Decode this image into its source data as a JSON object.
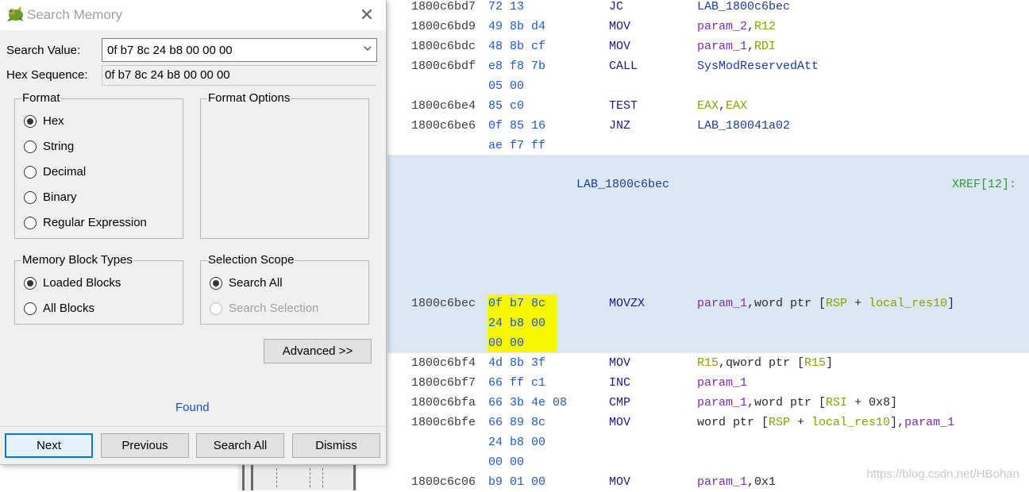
{
  "dialog": {
    "title": "Search Memory",
    "search_value_label": "Search Value:",
    "search_value": "0f b7 8c 24 b8 00 00 00",
    "hex_sequence_label": "Hex Sequence:",
    "hex_sequence": "0f b7 8c 24 b8 00 00 00",
    "format": {
      "title": "Format",
      "options": [
        "Hex",
        "String",
        "Decimal",
        "Binary",
        "Regular Expression"
      ],
      "selected": "Hex"
    },
    "format_options_title": "Format Options",
    "memory_block_types": {
      "title": "Memory Block Types",
      "options": [
        "Loaded Blocks",
        "All Blocks"
      ],
      "selected": "Loaded Blocks"
    },
    "selection_scope": {
      "title": "Selection Scope",
      "options": [
        "Search All",
        "Search Selection"
      ],
      "selected": "Search All"
    },
    "advanced_button": "Advanced >>",
    "status": "Found",
    "buttons": {
      "next": "Next",
      "previous": "Previous",
      "search_all": "Search All",
      "dismiss": "Dismiss"
    }
  },
  "listing": {
    "rows": [
      {
        "addr": "1800c6bd7",
        "bytes": "72 13",
        "mnemonic": "JC",
        "operands": [
          {
            "t": "LAB_1800c6bec",
            "k": "label"
          }
        ]
      },
      {
        "addr": "1800c6bd9",
        "bytes": "49 8b d4",
        "mnemonic": "MOV",
        "operands": [
          {
            "t": "param_2",
            "k": "param"
          },
          {
            "t": ",",
            "k": "plain"
          },
          {
            "t": "R12",
            "k": "reg"
          }
        ]
      },
      {
        "addr": "1800c6bdc",
        "bytes": "48 8b cf",
        "mnemonic": "MOV",
        "operands": [
          {
            "t": "param_1",
            "k": "param"
          },
          {
            "t": ",",
            "k": "plain"
          },
          {
            "t": "RDI",
            "k": "reg"
          }
        ]
      },
      {
        "addr": "1800c6bdf",
        "bytes": "e8 f8 7b",
        "mnemonic": "CALL",
        "operands": [
          {
            "t": "SysModReservedAtt",
            "k": "label"
          }
        ]
      },
      {
        "addr": "",
        "bytes": "05 00",
        "mnemonic": "",
        "operands": []
      },
      {
        "addr": "1800c6be4",
        "bytes": "85 c0",
        "mnemonic": "TEST",
        "operands": [
          {
            "t": "EAX",
            "k": "reg"
          },
          {
            "t": ",",
            "k": "plain"
          },
          {
            "t": "EAX",
            "k": "reg"
          }
        ]
      },
      {
        "addr": "1800c6be6",
        "bytes": "0f 85 16",
        "mnemonic": "JNZ",
        "operands": [
          {
            "t": "LAB_180041a02",
            "k": "label"
          }
        ]
      },
      {
        "addr": "",
        "bytes": "ae f7 ff",
        "mnemonic": "",
        "operands": []
      }
    ],
    "label": "LAB_1800c6bec",
    "xref": "XREF[12]:",
    "block_rows": [
      {
        "addr": "1800c6bec",
        "bytes": "0f b7 8c",
        "mnemonic": "MOVZX",
        "operands": [
          {
            "t": "param_1",
            "k": "param"
          },
          {
            "t": ",word ptr [",
            "k": "plain"
          },
          {
            "t": "RSP",
            "k": "reg"
          },
          {
            "t": " + ",
            "k": "plain"
          },
          {
            "t": "local_res10",
            "k": "local"
          },
          {
            "t": "]",
            "k": "plain"
          }
        ]
      },
      {
        "addr": "",
        "bytes": "24 b8 00",
        "mnemonic": "",
        "operands": []
      },
      {
        "addr": "",
        "bytes": "00 00",
        "mnemonic": "",
        "operands": []
      }
    ],
    "rows_after": [
      {
        "addr": "1800c6bf4",
        "bytes": "4d 8b 3f",
        "mnemonic": "MOV",
        "operands": [
          {
            "t": "R15",
            "k": "reg"
          },
          {
            "t": ",qword ptr [",
            "k": "plain"
          },
          {
            "t": "R15",
            "k": "reg"
          },
          {
            "t": "]",
            "k": "plain"
          }
        ]
      },
      {
        "addr": "1800c6bf7",
        "bytes": "66 ff c1",
        "mnemonic": "INC",
        "operands": [
          {
            "t": "param_1",
            "k": "param"
          }
        ]
      },
      {
        "addr": "1800c6bfa",
        "bytes": "66 3b 4e 08",
        "mnemonic": "CMP",
        "operands": [
          {
            "t": "param_1",
            "k": "param"
          },
          {
            "t": ",word ptr [",
            "k": "plain"
          },
          {
            "t": "RSI",
            "k": "reg"
          },
          {
            "t": " + 0x8]",
            "k": "plain"
          }
        ]
      },
      {
        "addr": "1800c6bfe",
        "bytes": "66 89 8c",
        "mnemonic": "MOV",
        "operands": [
          {
            "t": "word ptr [",
            "k": "plain"
          },
          {
            "t": "RSP",
            "k": "reg"
          },
          {
            "t": " + ",
            "k": "plain"
          },
          {
            "t": "local_res10",
            "k": "local"
          },
          {
            "t": "],",
            "k": "plain"
          },
          {
            "t": "param_1",
            "k": "param"
          }
        ]
      },
      {
        "addr": "",
        "bytes": "24 b8 00",
        "mnemonic": "",
        "operands": []
      },
      {
        "addr": "",
        "bytes": "00 00",
        "mnemonic": "",
        "operands": []
      },
      {
        "addr": "1800c6c06",
        "bytes": "b9 01 00",
        "mnemonic": "MOV",
        "operands": [
          {
            "t": "param_1",
            "k": "param"
          },
          {
            "t": ",0x1",
            "k": "plain"
          }
        ]
      }
    ]
  },
  "watermark": "https://blog.csdn.net/HBohan",
  "colors": {
    "highlight": "#f7f700",
    "block_bg": "#dbe7f3",
    "found": "#1f4fbf"
  },
  "icons": {
    "title": "dragon-icon",
    "close": "close-icon",
    "dropdown": "chevron-down-icon"
  }
}
